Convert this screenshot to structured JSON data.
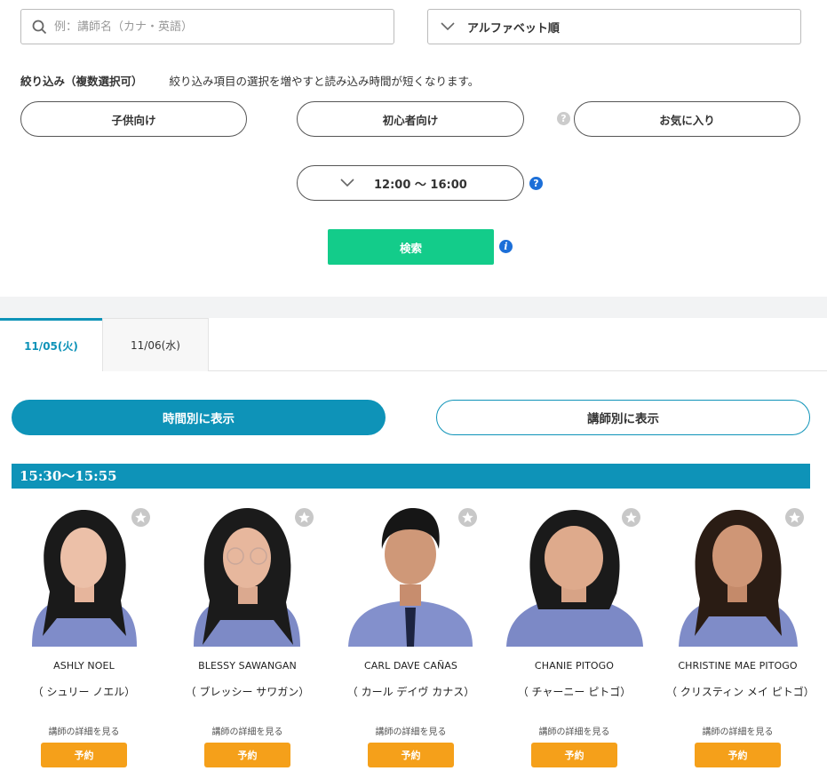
{
  "search": {
    "placeholder": "例：講師名（カナ・英語）"
  },
  "sort": {
    "selected": "アルファベット順"
  },
  "filter": {
    "title": "絞り込み（複数選択可）",
    "note": "絞り込み項目の選択を増やすと読み込み時間が短くなります。",
    "options": [
      "子供向け",
      "初心者向け",
      "お気に入り"
    ],
    "time_range": "12:00 ～ 16:00",
    "help_glyph": "?",
    "info_glyph": "i"
  },
  "search_button": "検索",
  "date_tabs": [
    {
      "label": "11/05(火)",
      "active": true
    },
    {
      "label": "11/06(水)",
      "active": false
    }
  ],
  "view_modes": {
    "by_time": "時間別に表示",
    "by_teacher": "講師別に表示"
  },
  "time_slot": "15:30～15:55",
  "teachers": [
    {
      "name": "ASHLY NOEL",
      "kana": "（ シュリー ノエル）",
      "detail": "講師の詳細を見る",
      "book": "予約"
    },
    {
      "name": "BLESSY SAWANGAN",
      "kana": "（ ブレッシー サワガン）",
      "detail": "講師の詳細を見る",
      "book": "予約"
    },
    {
      "name": "CARL DAVE CAÑAS",
      "kana": "（ カール デイヴ カナス）",
      "detail": "講師の詳細を見る",
      "book": "予約"
    },
    {
      "name": "CHANIE PITOGO",
      "kana": "（ チャーニー ピトゴ）",
      "detail": "講師の詳細を見る",
      "book": "予約"
    },
    {
      "name": "CHRISTINE MAE PITOGO",
      "kana": "（ クリスティン メイ ピトゴ）",
      "detail": "講師の詳細を見る",
      "book": "予約"
    }
  ],
  "colors": {
    "accent": "#0e93b8",
    "search_green": "#13cc8a",
    "book_orange": "#f5a01a",
    "help_blue": "#1c6fd8"
  }
}
